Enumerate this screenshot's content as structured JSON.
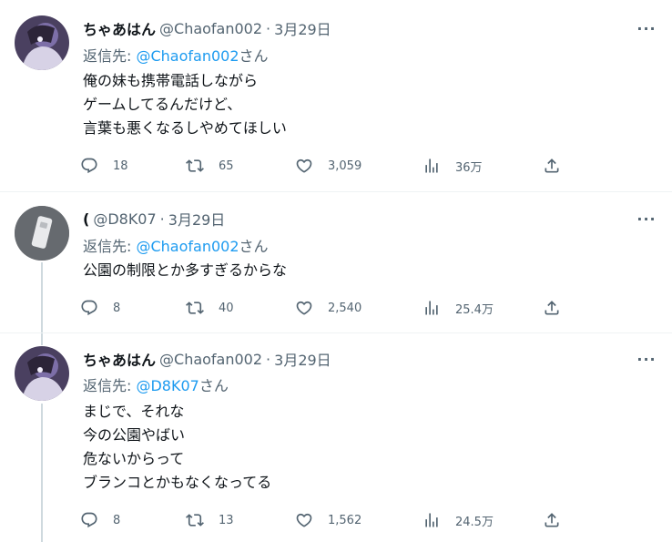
{
  "tweets": [
    {
      "display_name": "ちゃあはん",
      "handle": "@Chaofan002",
      "separator": "·",
      "date": "3月29日",
      "reply_prefix": "返信先: ",
      "reply_handle": "@Chaofan002",
      "reply_suffix": "さん",
      "lines": [
        "俺の妹も携帯電話しながら",
        "ゲームしてるんだけど、",
        "言葉も悪くなるしやめてほしい"
      ],
      "replies": "18",
      "retweets": "65",
      "likes": "3,059",
      "views": "36万"
    },
    {
      "display_name": "(",
      "handle": "@D8K07",
      "separator": "·",
      "date": "3月29日",
      "reply_prefix": "返信先: ",
      "reply_handle": "@Chaofan002",
      "reply_suffix": "さん",
      "lines": [
        "公園の制限とか多すぎるからな"
      ],
      "replies": "8",
      "retweets": "40",
      "likes": "2,540",
      "views": "25.4万"
    },
    {
      "display_name": "ちゃあはん",
      "handle": "@Chaofan002",
      "separator": "·",
      "date": "3月29日",
      "reply_prefix": "返信先: ",
      "reply_handle": "@D8K07",
      "reply_suffix": "さん",
      "lines": [
        "まじで、それな",
        "今の公園やばい",
        "危ないからって",
        "ブランコとかもなくなってる"
      ],
      "replies": "8",
      "retweets": "13",
      "likes": "1,562",
      "views": "24.5万"
    }
  ],
  "more_label": "···",
  "icons": {
    "reply": "reply-icon",
    "retweet": "retweet-icon",
    "like": "heart-icon",
    "views": "views-icon",
    "share": "share-icon",
    "more": "more-icon"
  }
}
